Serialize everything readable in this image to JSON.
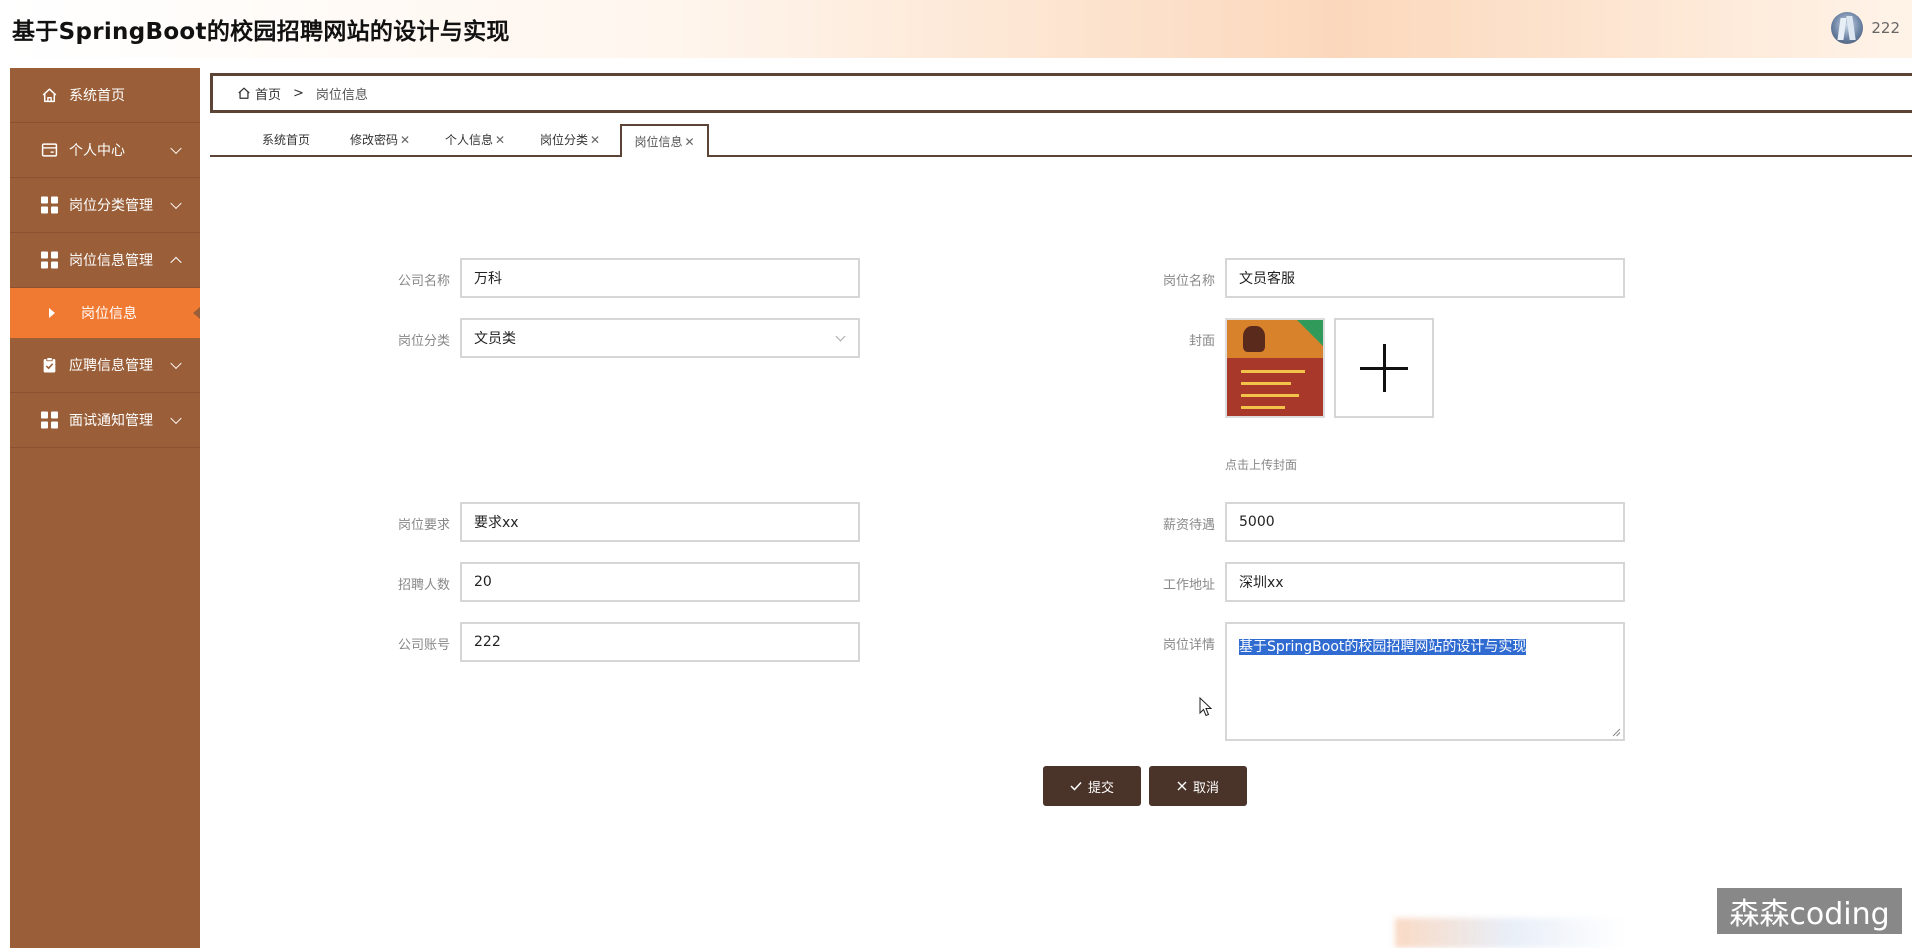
{
  "app": {
    "title": "基于SpringBoot的校园招聘网站的设计与实现",
    "username": "222"
  },
  "sidebar": {
    "items": [
      {
        "label": "系统首页",
        "icon": "home-icon"
      },
      {
        "label": "个人中心",
        "icon": "wallet-icon"
      },
      {
        "label": "岗位分类管理",
        "icon": "grid-icon"
      },
      {
        "label": "岗位信息管理",
        "icon": "grid-icon",
        "expanded": true
      },
      {
        "label": "应聘信息管理",
        "icon": "clipboard-icon"
      },
      {
        "label": "面试通知管理",
        "icon": "grid-icon"
      }
    ],
    "active_sub": {
      "label": "岗位信息"
    }
  },
  "breadcrumb": {
    "home": "首页",
    "separator": ">",
    "current": "岗位信息"
  },
  "tabs": [
    {
      "label": "系统首页",
      "closable": false
    },
    {
      "label": "修改密码",
      "closable": true
    },
    {
      "label": "个人信息",
      "closable": true
    },
    {
      "label": "岗位分类",
      "closable": true
    },
    {
      "label": "岗位信息",
      "closable": true,
      "active": true
    }
  ],
  "form": {
    "company_name": {
      "label": "公司名称",
      "value": "万科"
    },
    "job_name": {
      "label": "岗位名称",
      "value": "文员客服"
    },
    "job_category": {
      "label": "岗位分类",
      "value": "文员类"
    },
    "cover": {
      "label": "封面",
      "hint": "点击上传封面"
    },
    "job_requirement": {
      "label": "岗位要求",
      "value": "要求xx"
    },
    "salary": {
      "label": "薪资待遇",
      "value": "5000"
    },
    "headcount": {
      "label": "招聘人数",
      "value": "20"
    },
    "work_address": {
      "label": "工作地址",
      "value": "深圳xx"
    },
    "company_account": {
      "label": "公司账号",
      "value": "222"
    },
    "job_detail": {
      "label": "岗位详情",
      "value": "基于SpringBoot的校园招聘网站的设计与实现"
    }
  },
  "buttons": {
    "submit": "提交",
    "cancel": "取消"
  },
  "watermark": "森森coding",
  "colors": {
    "sidebar": "#9a5f38",
    "active": "#f07a32",
    "dark": "#4a3329",
    "selection": "#2f6bd0"
  }
}
